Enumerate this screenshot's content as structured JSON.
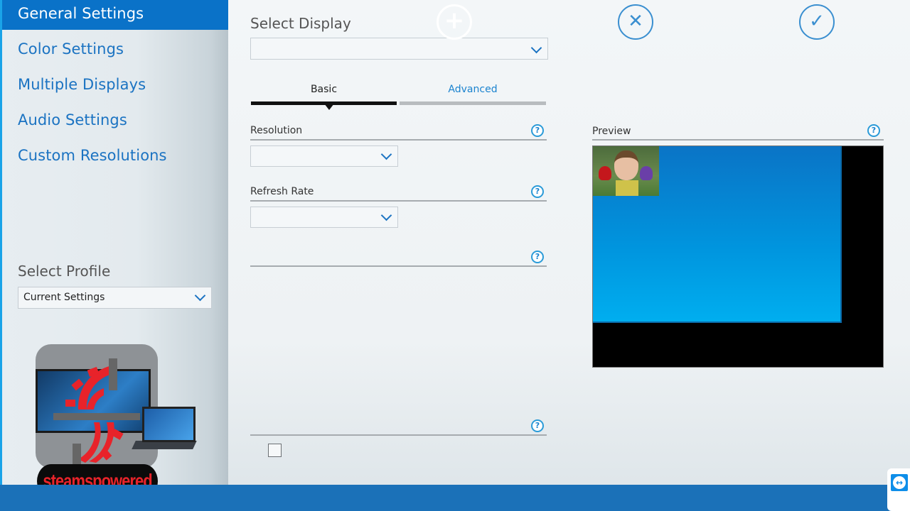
{
  "sidebar": {
    "items": [
      {
        "label": "General Settings",
        "active": true
      },
      {
        "label": "Color Settings",
        "active": false
      },
      {
        "label": "Multiple Displays",
        "active": false
      },
      {
        "label": "Audio Settings",
        "active": false
      },
      {
        "label": "Custom Resolutions",
        "active": false
      }
    ],
    "profile": {
      "label": "Select Profile",
      "value": "Current Settings"
    }
  },
  "watermark": {
    "text": "steamspowered"
  },
  "main": {
    "select_display": {
      "label": "Select Display",
      "value": ""
    },
    "tabs": [
      {
        "label": "Basic",
        "active": true
      },
      {
        "label": "Advanced",
        "active": false
      }
    ],
    "resolution": {
      "label": "Resolution",
      "value": "",
      "help": "?"
    },
    "refresh_rate": {
      "label": "Refresh Rate",
      "value": "",
      "help": "?"
    },
    "section3": {
      "label": "",
      "help": "?"
    },
    "section4": {
      "label": "",
      "help": "?",
      "checkbox_checked": false
    },
    "preview": {
      "label": "Preview",
      "help": "?"
    }
  },
  "bottom_bar": {
    "add_glyph": "+",
    "cancel_glyph": "✕",
    "apply_glyph": "✓"
  },
  "colors": {
    "accent": "#0a72c8",
    "link": "#1b73c2",
    "bottom_bar": "#1b71b8",
    "help_icon": "#2b9bd8"
  }
}
